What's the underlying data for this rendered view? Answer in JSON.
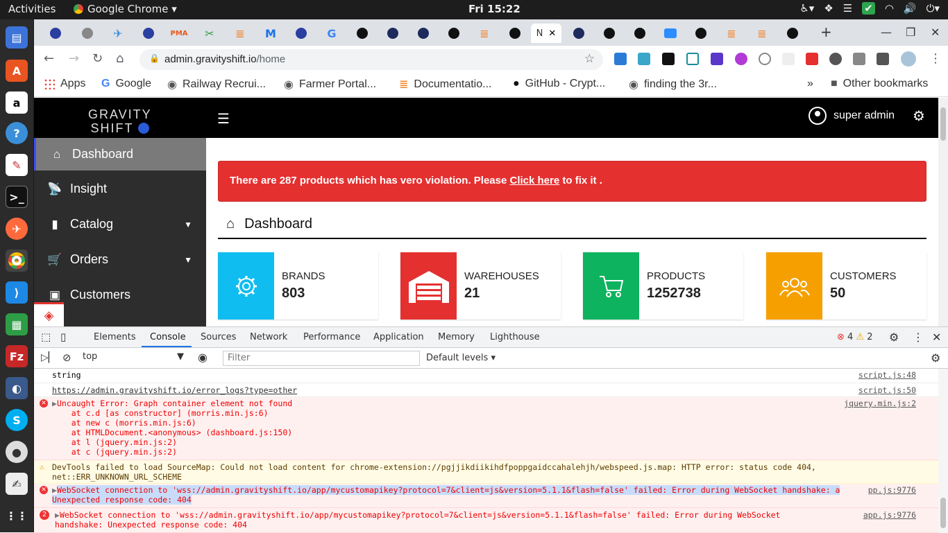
{
  "topbar": {
    "activities": "Activities",
    "app_name": "Google Chrome",
    "clock": "Fri 15:22"
  },
  "browser": {
    "url_domain": "admin.gravityshift.io",
    "url_path": "/home",
    "active_tab_title": "N"
  },
  "bookmarks": [
    {
      "label": "Apps",
      "icon": "apps-grid-icon"
    },
    {
      "label": "Google",
      "icon": "google-icon"
    },
    {
      "label": "Railway Recrui...",
      "icon": "globe-icon"
    },
    {
      "label": "Farmer Portal...",
      "icon": "globe-icon"
    },
    {
      "label": "Documentatio...",
      "icon": "stackoverflow-icon"
    },
    {
      "label": "GitHub - Crypt...",
      "icon": "github-icon"
    },
    {
      "label": "finding the 3r...",
      "icon": "globe-icon"
    }
  ],
  "bookmarks_more": "»",
  "other_bookmarks": "Other bookmarks",
  "site": {
    "logo_line1": "GRAVITY",
    "logo_line2": "SHIFT",
    "user_name": "super admin",
    "sidebar": [
      {
        "label": "Dashboard",
        "icon": "home-icon",
        "active": true
      },
      {
        "label": "Insight",
        "icon": "satellite-icon"
      },
      {
        "label": "Catalog",
        "icon": "book-icon",
        "chevron": true
      },
      {
        "label": "Orders",
        "icon": "cart-icon",
        "chevron": true
      },
      {
        "label": "Customers",
        "icon": "id-card-icon"
      }
    ],
    "alert": {
      "before": "There are 287 products which has vero violation. Please ",
      "link": "Click here",
      "after": " to fix it ."
    },
    "page_title": "Dashboard",
    "cards": [
      {
        "label": "BRANDS",
        "value": "803",
        "color": "#10bdf0",
        "icon": "gear-icon"
      },
      {
        "label": "WAREHOUSES",
        "value": "21",
        "color": "#e53030",
        "icon": "warehouse-icon"
      },
      {
        "label": "PRODUCTS",
        "value": "1252738",
        "color": "#0db35e",
        "icon": "cart-icon"
      },
      {
        "label": "CUSTOMERS",
        "value": "50",
        "color": "#f5a000",
        "icon": "users-icon"
      }
    ]
  },
  "devtools": {
    "tabs": [
      "Elements",
      "Console",
      "Sources",
      "Network",
      "Performance",
      "Application",
      "Memory",
      "Lighthouse"
    ],
    "active_tab": "Console",
    "error_count": "4",
    "warning_count": "2",
    "context": "top",
    "filter_placeholder": "Filter",
    "levels": "Default levels",
    "messages": [
      {
        "type": "log",
        "text": "string",
        "source": "script.js:48"
      },
      {
        "type": "log",
        "text": "https://admin.gravityshift.io/error_logs?type=other",
        "source": "script.js:50"
      },
      {
        "type": "error",
        "text": "Uncaught Error: Graph container element not found",
        "stack": [
          "    at c.d [as constructor] (morris.min.js:6)",
          "    at new c (morris.min.js:6)",
          "    at HTMLDocument.<anonymous> (dashboard.js:150)",
          "    at l (jquery.min.js:2)",
          "    at c (jquery.min.js:2)"
        ],
        "source": "jquery.min.js:2"
      },
      {
        "type": "warning",
        "text": "DevTools failed to load SourceMap: Could not load content for chrome-extension://pgjjikdiikihdfpoppgaidccahalehjh/webspeed.js.map: HTTP error: status code 404,",
        "text2": "net::ERR_UNKNOWN_URL_SCHEME"
      },
      {
        "type": "error",
        "text": "WebSocket connection to 'wss://admin.gravityshift.io/app/mycustomapikey?protocol=7&client=js&version=5.1.1&flash=false' failed: Error during WebSocket handshake: a",
        "text2": "Unexpected response code: 404",
        "source": "pp.js:9776"
      },
      {
        "type": "error",
        "count": "2",
        "text": "WebSocket connection to 'wss://admin.gravityshift.io/app/mycustomapikey?protocol=7&client=js&version=5.1.1&flash=false' failed: Error during WebSocket",
        "text2": "handshake: Unexpected response code: 404",
        "source": "app.js:9776"
      }
    ]
  }
}
